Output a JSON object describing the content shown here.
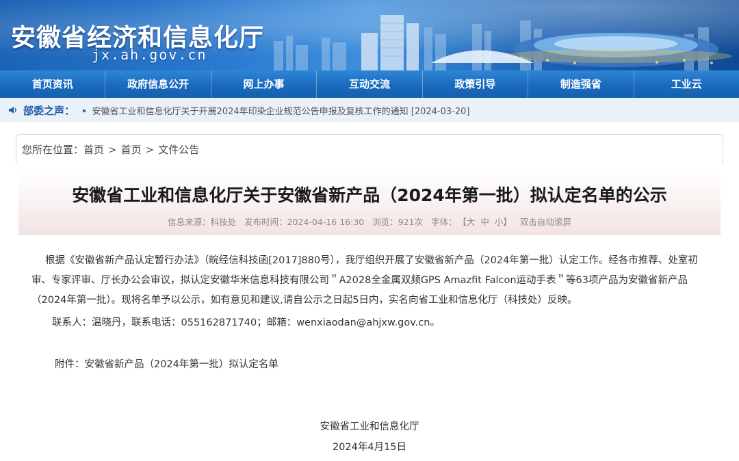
{
  "header": {
    "site_title": "安徽省经济和信息化厅",
    "site_domain": "jx.ah.gov.cn"
  },
  "nav": {
    "items": [
      {
        "label": "首页资讯"
      },
      {
        "label": "政府信息公开"
      },
      {
        "label": "网上办事"
      },
      {
        "label": "互动交流"
      },
      {
        "label": "政策引导"
      },
      {
        "label": "制造强省"
      },
      {
        "label": "工业云"
      }
    ]
  },
  "notice": {
    "label": "部委之声：",
    "link_text": "安徽省工业和信息化厅关于开展2024年印染企业规范公告申报及复核工作的通知 [2024-03-20]"
  },
  "breadcrumb": {
    "prefix": "您所在位置：",
    "items": [
      "首页",
      "首页",
      "文件公告"
    ],
    "separator": ">"
  },
  "article": {
    "title": "安徽省工业和信息化厅关于安徽省新产品（2024年第一批）拟认定名单的公示",
    "meta": {
      "source": "信息来源：科技处",
      "published": "发布时间：2024-04-16 16:30",
      "views": "浏览：921次",
      "font_label": "字体：",
      "font_big": "【大",
      "font_mid": "中",
      "font_small": "小】",
      "autoscroll": "双击自动滚屏"
    },
    "paragraph_1": "根据《安徽省新产品认定暂行办法》（皖经信科技函[2017]880号），我厅组织开展了安徽省新产品（2024年第一批）认定工作。经各市推荐、处室初审、专家评审、厅长办公会审议，拟认定安徽华米信息科技有限公司＂A2028全金属双频GPS Amazfit Falcon运动手表＂等63项产品为安徽省新产品（2024年第一批）。现将名单予以公示，如有意见和建议,请自公示之日起5日内，实名向省工业和信息化厅（科技处）反映。",
    "contact": "联系人：温晓丹，联系电话：055162871740；邮箱：wenxiaodan@ahjxw.gov.cn。",
    "attachment": "附件：安徽省新产品（2024年第一批）拟认定名单",
    "signature_org": "安徽省工业和信息化厅",
    "signature_date": "2024年4月15日"
  }
}
